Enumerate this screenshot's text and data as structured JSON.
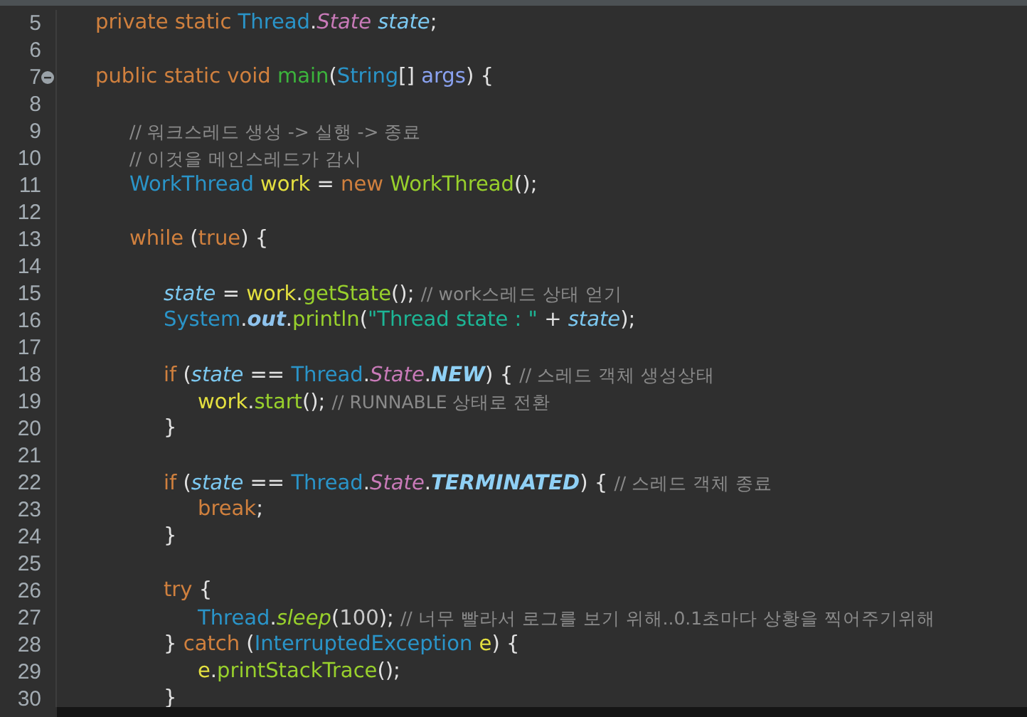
{
  "editor": {
    "lines": [
      {
        "number": "5",
        "tokens": [
          {
            "kind": "keyword",
            "text": "private static "
          },
          {
            "kind": "type",
            "text": "Thread"
          },
          {
            "kind": "plain",
            "text": "."
          },
          {
            "kind": "enum",
            "text": "State "
          },
          {
            "kind": "field",
            "text": "state"
          },
          {
            "kind": "plain",
            "text": ";"
          }
        ]
      },
      {
        "number": "6"
      },
      {
        "number": "7",
        "fold_marker": true,
        "tokens": [
          {
            "kind": "keyword",
            "text": "public static void "
          },
          {
            "kind": "method_decl",
            "text": "main"
          },
          {
            "kind": "plain",
            "text": "("
          },
          {
            "kind": "type",
            "text": "String"
          },
          {
            "kind": "plain",
            "text": "[] "
          },
          {
            "kind": "param",
            "text": "args"
          },
          {
            "kind": "plain",
            "text": ") {"
          }
        ],
        "children": [
          {
            "number": "8"
          },
          {
            "number": "9",
            "tokens": [
              {
                "kind": "comment",
                "text": "// 워크스레드 생성 -> 실행 -> 종료"
              }
            ]
          },
          {
            "number": "10",
            "tokens": [
              {
                "kind": "comment",
                "text": "// 이것을 메인스레드가 감시"
              }
            ]
          },
          {
            "number": "11",
            "tokens": [
              {
                "kind": "type",
                "text": "WorkThread "
              },
              {
                "kind": "local",
                "text": "work"
              },
              {
                "kind": "plain",
                "text": " = "
              },
              {
                "kind": "keyword",
                "text": "new "
              },
              {
                "kind": "method",
                "text": "WorkThread"
              },
              {
                "kind": "plain",
                "text": "();"
              }
            ]
          },
          {
            "number": "12"
          },
          {
            "number": "13",
            "tokens": [
              {
                "kind": "keyword",
                "text": "while"
              },
              {
                "kind": "plain",
                "text": " ("
              },
              {
                "kind": "keyword",
                "text": "true"
              },
              {
                "kind": "plain",
                "text": ") {"
              }
            ],
            "children": [
              {
                "number": "14"
              },
              {
                "number": "15",
                "tokens": [
                  {
                    "kind": "field",
                    "text": "state"
                  },
                  {
                    "kind": "plain",
                    "text": " = "
                  },
                  {
                    "kind": "local",
                    "text": "work"
                  },
                  {
                    "kind": "plain",
                    "text": "."
                  },
                  {
                    "kind": "method",
                    "text": "getState"
                  },
                  {
                    "kind": "plain",
                    "text": "(); "
                  },
                  {
                    "kind": "comment",
                    "text": "// work스레드 상태 얻기"
                  }
                ]
              },
              {
                "number": "16",
                "tokens": [
                  {
                    "kind": "type",
                    "text": "System"
                  },
                  {
                    "kind": "plain",
                    "text": "."
                  },
                  {
                    "kind": "static_field",
                    "text": "out"
                  },
                  {
                    "kind": "plain",
                    "text": "."
                  },
                  {
                    "kind": "method",
                    "text": "println"
                  },
                  {
                    "kind": "plain",
                    "text": "("
                  },
                  {
                    "kind": "string",
                    "text": "\"Thread state : \""
                  },
                  {
                    "kind": "plain",
                    "text": " + "
                  },
                  {
                    "kind": "field",
                    "text": "state"
                  },
                  {
                    "kind": "plain",
                    "text": ");"
                  }
                ]
              },
              {
                "number": "17"
              },
              {
                "number": "18",
                "tokens": [
                  {
                    "kind": "keyword",
                    "text": "if"
                  },
                  {
                    "kind": "plain",
                    "text": " ("
                  },
                  {
                    "kind": "field",
                    "text": "state"
                  },
                  {
                    "kind": "plain",
                    "text": " == "
                  },
                  {
                    "kind": "type",
                    "text": "Thread"
                  },
                  {
                    "kind": "plain",
                    "text": "."
                  },
                  {
                    "kind": "enum",
                    "text": "State"
                  },
                  {
                    "kind": "plain",
                    "text": "."
                  },
                  {
                    "kind": "constant",
                    "text": "NEW"
                  },
                  {
                    "kind": "plain",
                    "text": ") { "
                  },
                  {
                    "kind": "comment",
                    "text": "// 스레드 객체 생성상태"
                  }
                ],
                "children": [
                  {
                    "number": "19",
                    "tokens": [
                      {
                        "kind": "local",
                        "text": "work"
                      },
                      {
                        "kind": "plain",
                        "text": "."
                      },
                      {
                        "kind": "method",
                        "text": "start"
                      },
                      {
                        "kind": "plain",
                        "text": "(); "
                      },
                      {
                        "kind": "comment",
                        "text": "// RUNNABLE 상태로 전환"
                      }
                    ]
                  }
                ]
              },
              {
                "number": "20",
                "tokens": [
                  {
                    "kind": "plain",
                    "text": "}"
                  }
                ]
              },
              {
                "number": "21"
              },
              {
                "number": "22",
                "tokens": [
                  {
                    "kind": "keyword",
                    "text": "if"
                  },
                  {
                    "kind": "plain",
                    "text": " ("
                  },
                  {
                    "kind": "field",
                    "text": "state"
                  },
                  {
                    "kind": "plain",
                    "text": " == "
                  },
                  {
                    "kind": "type",
                    "text": "Thread"
                  },
                  {
                    "kind": "plain",
                    "text": "."
                  },
                  {
                    "kind": "enum",
                    "text": "State"
                  },
                  {
                    "kind": "plain",
                    "text": "."
                  },
                  {
                    "kind": "constant",
                    "text": "TERMINATED"
                  },
                  {
                    "kind": "plain",
                    "text": ") { "
                  },
                  {
                    "kind": "comment",
                    "text": "// 스레드 객체 종료"
                  }
                ],
                "children": [
                  {
                    "number": "23",
                    "tokens": [
                      {
                        "kind": "keyword",
                        "text": "break"
                      },
                      {
                        "kind": "plain",
                        "text": ";"
                      }
                    ]
                  }
                ]
              },
              {
                "number": "24",
                "tokens": [
                  {
                    "kind": "plain",
                    "text": "}"
                  }
                ]
              },
              {
                "number": "25"
              },
              {
                "number": "26",
                "tokens": [
                  {
                    "kind": "keyword",
                    "text": "try"
                  },
                  {
                    "kind": "plain",
                    "text": " {"
                  }
                ],
                "children": [
                  {
                    "number": "27",
                    "tokens": [
                      {
                        "kind": "type",
                        "text": "Thread"
                      },
                      {
                        "kind": "plain",
                        "text": "."
                      },
                      {
                        "kind": "static_method",
                        "text": "sleep"
                      },
                      {
                        "kind": "plain",
                        "text": "("
                      },
                      {
                        "kind": "number",
                        "text": "100"
                      },
                      {
                        "kind": "plain",
                        "text": "); "
                      },
                      {
                        "kind": "comment",
                        "text": "// 너무 빨라서 로그를 보기 위해..0.1초마다 상황을 찍어주기위해"
                      }
                    ]
                  }
                ]
              },
              {
                "number": "28",
                "tokens": [
                  {
                    "kind": "plain",
                    "text": "} "
                  },
                  {
                    "kind": "keyword",
                    "text": "catch"
                  },
                  {
                    "kind": "plain",
                    "text": " ("
                  },
                  {
                    "kind": "type",
                    "text": "InterruptedException "
                  },
                  {
                    "kind": "local",
                    "text": "e"
                  },
                  {
                    "kind": "plain",
                    "text": ") {"
                  }
                ],
                "children": [
                  {
                    "number": "29",
                    "tokens": [
                      {
                        "kind": "local",
                        "text": "e"
                      },
                      {
                        "kind": "plain",
                        "text": "."
                      },
                      {
                        "kind": "method",
                        "text": "printStackTrace"
                      },
                      {
                        "kind": "plain",
                        "text": "();"
                      }
                    ]
                  }
                ]
              },
              {
                "number": "30",
                "tokens": [
                  {
                    "kind": "plain",
                    "text": "}"
                  }
                ]
              }
            ]
          }
        ]
      }
    ]
  }
}
